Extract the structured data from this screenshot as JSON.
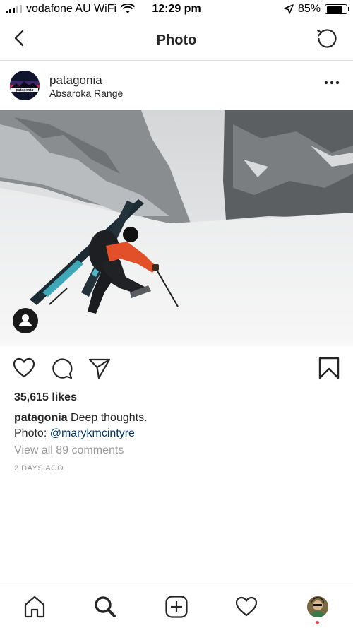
{
  "status_bar": {
    "carrier": "vodafone AU WiFi",
    "time": "12:29 pm",
    "battery_percent": "85%",
    "battery_level": 0.85,
    "icons": [
      "signal-icon",
      "wifi-icon",
      "location-arrow-icon",
      "battery-icon"
    ]
  },
  "nav": {
    "title": "Photo",
    "icons": [
      "back-chevron-icon",
      "refresh-icon"
    ]
  },
  "post": {
    "username": "patagonia",
    "location": "Absaroka Range",
    "avatar_text": "patagonia",
    "likes": "35,615 likes",
    "caption_user": "patagonia",
    "caption_text": "Deep thoughts.",
    "caption_line2_prefix": "Photo: ",
    "caption_mention": "@marykmcintyre",
    "comments_link": "View all 89 comments",
    "time_ago": "2 DAYS AGO",
    "icons": [
      "more-options-icon",
      "user-tag-icon",
      "heart-icon",
      "comment-icon",
      "share-icon",
      "bookmark-icon"
    ]
  },
  "tab_bar": {
    "items": [
      "home-icon",
      "search-icon",
      "new-post-icon",
      "activity-icon",
      "profile-avatar"
    ]
  },
  "colors": {
    "text": "#262626",
    "muted": "#999999",
    "mention": "#003569",
    "divider": "#dbdbdb",
    "notification_dot": "#ed4956"
  }
}
